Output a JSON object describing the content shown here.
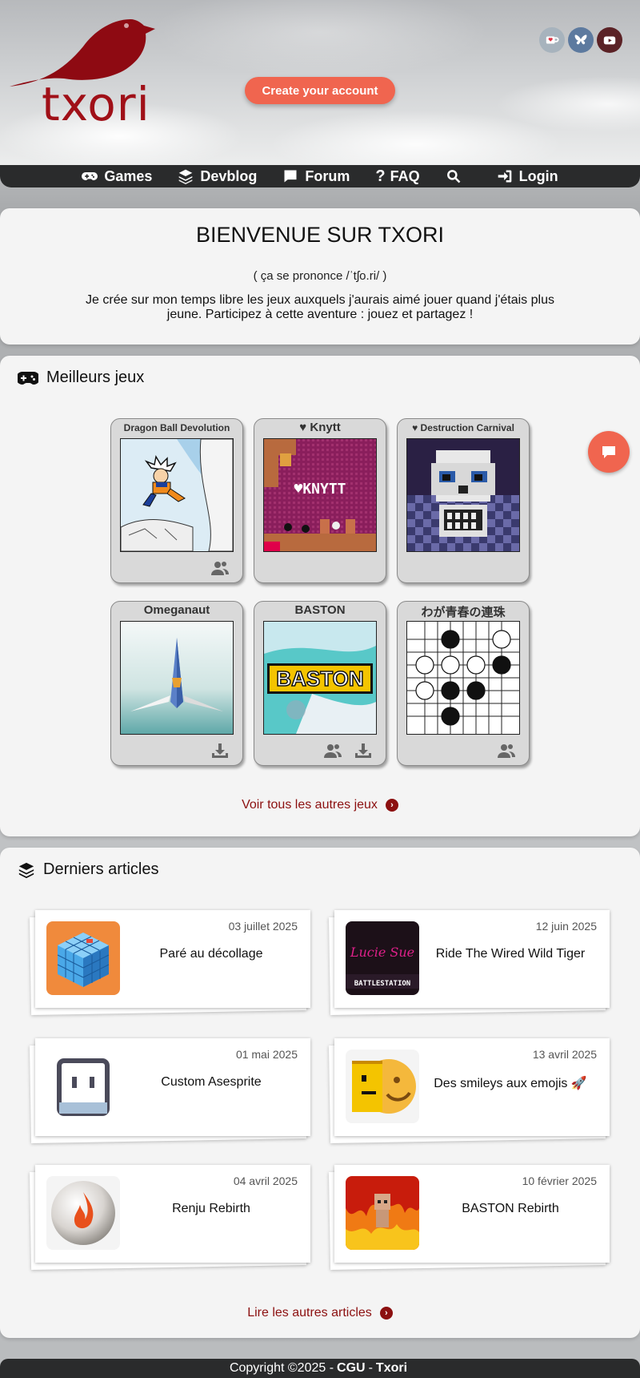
{
  "header": {
    "logo_text": "txori",
    "cta_label": "Create your account",
    "social": [
      {
        "icon": "kofi-icon",
        "color": "#a7b3bd"
      },
      {
        "icon": "bluesky-icon",
        "color": "#5d7a9f"
      },
      {
        "icon": "youtube-icon",
        "color": "#5b2226"
      }
    ]
  },
  "nav": {
    "games": "Games",
    "devblog": "Devblog",
    "forum": "Forum",
    "faq": "FAQ",
    "login": "Login"
  },
  "welcome": {
    "title": "BIENVENUE SUR TXORI",
    "pronunciation": "( ça se prononce /ˈtʃo.ri/ )",
    "text": "Je crée sur mon temps libre les jeux auxquels j'aurais aimé jouer quand j'étais plus jeune. Participez à cette aventure : jouez et partagez !"
  },
  "best_games": {
    "title": "Meilleurs jeux",
    "games": [
      {
        "title": "Dragon Ball Devolution",
        "favorite": false,
        "icons": [
          "users-icon"
        ]
      },
      {
        "title": "Knytt",
        "favorite": true,
        "icons": []
      },
      {
        "title": "Destruction Carnival",
        "favorite": true,
        "icons": []
      },
      {
        "title": "Omeganaut",
        "favorite": false,
        "icons": [
          "download-icon"
        ]
      },
      {
        "title": "BASTON",
        "favorite": false,
        "icons": [
          "users-icon",
          "download-icon"
        ]
      },
      {
        "title": "わが青春の連珠",
        "favorite": false,
        "icons": [
          "users-icon"
        ]
      }
    ],
    "knytt_logo": "♥KNYTT",
    "baston_logo": "BASTON",
    "more_link": "Voir tous les autres jeux"
  },
  "articles": {
    "title": "Derniers articles",
    "items": [
      {
        "date": "03 juillet 2025",
        "title": "Paré au décollage"
      },
      {
        "date": "12 juin 2025",
        "title": "Ride The Wired Wild Tiger"
      },
      {
        "date": "01 mai 2025",
        "title": "Custom Asesprite"
      },
      {
        "date": "13 avril 2025",
        "title": "Des smileys aux emojis 🚀"
      },
      {
        "date": "04 avril 2025",
        "title": "Renju Rebirth"
      },
      {
        "date": "10 février 2025",
        "title": "BASTON Rebirth"
      }
    ],
    "tiger_caption": "BATTLESTATION",
    "tiger_script": "Lucie Sue",
    "more_link": "Lire les autres articles"
  },
  "footer": {
    "copyright": "Copyright ©2025 -",
    "cgu": "CGU",
    "sep": "-",
    "brand": "Txori"
  }
}
